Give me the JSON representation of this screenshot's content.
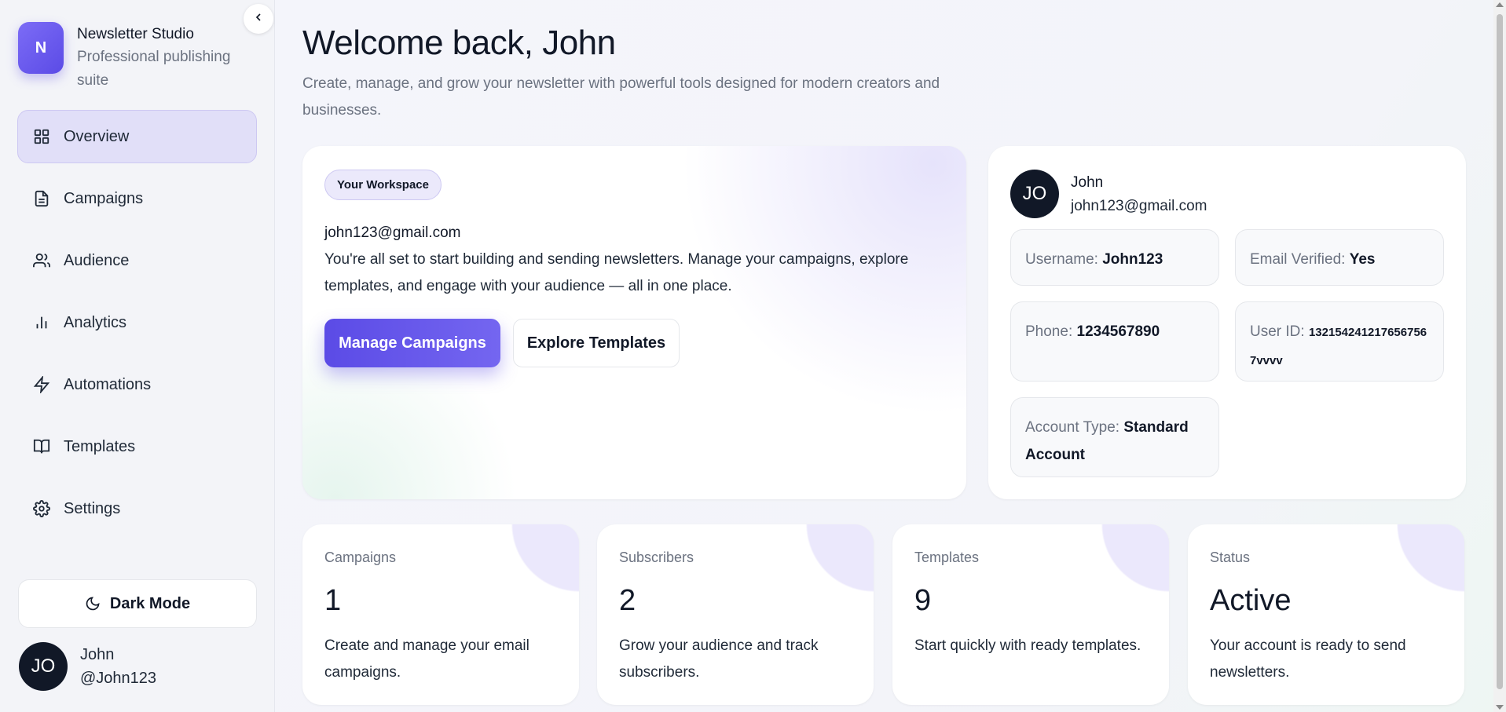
{
  "sidebar": {
    "brand": {
      "logo_letter": "N",
      "name": "Newsletter Studio",
      "subtitle": "Professional publishing suite"
    },
    "items": [
      {
        "label": "Overview",
        "icon": "grid-icon",
        "active": true
      },
      {
        "label": "Campaigns",
        "icon": "document-icon"
      },
      {
        "label": "Audience",
        "icon": "users-icon"
      },
      {
        "label": "Analytics",
        "icon": "bar-chart-icon"
      },
      {
        "label": "Automations",
        "icon": "lightning-icon"
      },
      {
        "label": "Templates",
        "icon": "book-icon"
      },
      {
        "label": "Settings",
        "icon": "gear-icon"
      }
    ],
    "dark_mode_label": "Dark Mode",
    "user": {
      "initials": "JO",
      "name": "John",
      "handle": "@John123"
    }
  },
  "header": {
    "title": "Welcome back, John",
    "subtitle": "Create, manage, and grow your newsletter with powerful tools designed for modern creators and businesses."
  },
  "workspace": {
    "badge": "Your Workspace",
    "email": "john123@gmail.com",
    "description": "You're all set to start building and sending newsletters. Manage your campaigns, explore templates, and engage with your audience — all in one place.",
    "primary_button": "Manage Campaigns",
    "secondary_button": "Explore Templates"
  },
  "profile": {
    "initials": "JO",
    "name": "John",
    "email": "john123@gmail.com",
    "username_label": "Username:",
    "username": "John123",
    "verified_label": "Email Verified:",
    "verified": "Yes",
    "phone_label": "Phone:",
    "phone": "1234567890",
    "userid_label": "User ID:",
    "userid": "1321542412176567567vvvv",
    "account_label": "Account Type:",
    "account": "Standard Account"
  },
  "stats": [
    {
      "label": "Campaigns",
      "value": "1",
      "desc": "Create and manage your email campaigns."
    },
    {
      "label": "Subscribers",
      "value": "2",
      "desc": "Grow your audience and track subscribers."
    },
    {
      "label": "Templates",
      "value": "9",
      "desc": "Start quickly with ready templates."
    },
    {
      "label": "Status",
      "value": "Active",
      "desc": "Your account is ready to send newsletters."
    }
  ],
  "colors": {
    "accent": "#5b4be6",
    "active_nav_bg": "#e1dff8",
    "avatar_bg": "#111827"
  }
}
